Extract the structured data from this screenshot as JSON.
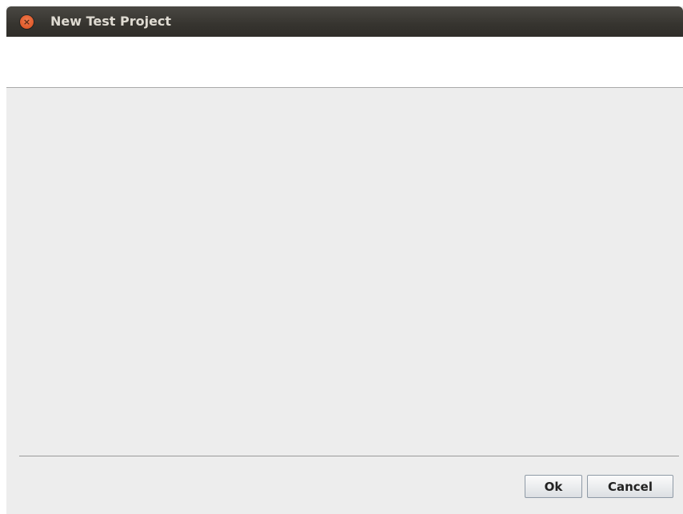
{
  "window": {
    "title": "New Test Project"
  },
  "buttons": {
    "ok_label": "Ok",
    "cancel_label": "Cancel"
  },
  "icons": {
    "close": "close-icon"
  },
  "colors": {
    "titlebar": "#3c3b37",
    "close_button": "#e35d2b",
    "body_background": "#ededed",
    "header_background": "#ffffff"
  }
}
